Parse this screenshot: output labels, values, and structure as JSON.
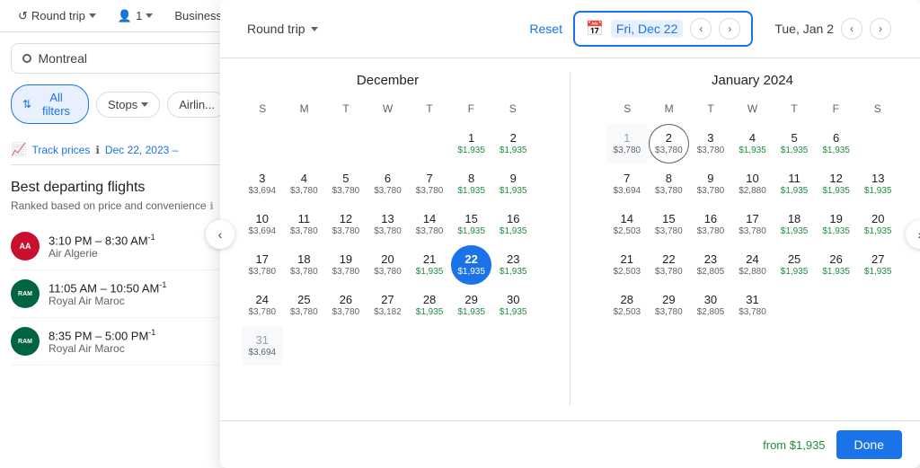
{
  "topbar": {
    "trip_type": "Round trip",
    "passengers": "1",
    "class": "Business",
    "trip_chevron": "▾",
    "passengers_chevron": "▾",
    "class_chevron": "▾"
  },
  "left_panel": {
    "search_placeholder": "Montreal",
    "filter_all": "All filters",
    "filter_stops": "Stops",
    "filter_airlines": "Airlin...",
    "track_prices_label": "Track prices",
    "track_prices_date": "Dec 22, 2023 –",
    "best_flights_title": "Best departing flights",
    "best_flights_sub": "Ranked based on price and convenience",
    "flights": [
      {
        "time": "3:10 PM – 8:30 AM",
        "suffix": "-1",
        "airline": "Air Algerie",
        "logo": "AA"
      },
      {
        "time": "11:05 AM – 10:50 AM",
        "suffix": "-1",
        "airline": "Royal Air Maroc",
        "logo": "RAM"
      },
      {
        "time": "8:35 PM – 5:00 PM",
        "suffix": "-1",
        "airline": "Royal Air Maroc",
        "logo": "RAM"
      }
    ]
  },
  "calendar_header": {
    "trip_type": "Round trip",
    "reset": "Reset",
    "depart_label": "Fri, Dec 22",
    "return_label": "Tue, Jan 2",
    "calendar_icon": "📅"
  },
  "december": {
    "title": "December",
    "day_headers": [
      "S",
      "M",
      "T",
      "W",
      "T",
      "F",
      "S"
    ],
    "weeks": [
      [
        {
          "num": "",
          "price": "",
          "type": "empty"
        },
        {
          "num": "",
          "price": "",
          "type": "empty"
        },
        {
          "num": "",
          "price": "",
          "type": "empty"
        },
        {
          "num": "",
          "price": "",
          "type": "empty"
        },
        {
          "num": "",
          "price": "",
          "type": "empty"
        },
        {
          "num": "1",
          "price": "$1,935",
          "type": "green"
        },
        {
          "num": "2",
          "price": "$1,935",
          "type": "green"
        }
      ],
      [
        {
          "num": "3",
          "price": "$3,694",
          "type": "gray"
        },
        {
          "num": "4",
          "price": "$3,780",
          "type": "gray"
        },
        {
          "num": "5",
          "price": "$3,780",
          "type": "gray"
        },
        {
          "num": "6",
          "price": "$3,780",
          "type": "gray"
        },
        {
          "num": "7",
          "price": "$3,780",
          "type": "gray"
        },
        {
          "num": "8",
          "price": "$1,935",
          "type": "green"
        },
        {
          "num": "9",
          "price": "$1,935",
          "type": "green"
        }
      ],
      [
        {
          "num": "10",
          "price": "$3,694",
          "type": "gray"
        },
        {
          "num": "11",
          "price": "$3,780",
          "type": "gray"
        },
        {
          "num": "12",
          "price": "$3,780",
          "type": "gray"
        },
        {
          "num": "13",
          "price": "$3,780",
          "type": "gray"
        },
        {
          "num": "14",
          "price": "$3,780",
          "type": "gray"
        },
        {
          "num": "15",
          "price": "$1,935",
          "type": "green"
        },
        {
          "num": "16",
          "price": "$1,935",
          "type": "green"
        }
      ],
      [
        {
          "num": "17",
          "price": "$3,780",
          "type": "gray"
        },
        {
          "num": "18",
          "price": "$3,780",
          "type": "gray"
        },
        {
          "num": "19",
          "price": "$3,780",
          "type": "gray"
        },
        {
          "num": "20",
          "price": "$3,780",
          "type": "gray"
        },
        {
          "num": "21",
          "price": "$1,935",
          "type": "green"
        },
        {
          "num": "22",
          "price": "$1,935",
          "type": "selected"
        },
        {
          "num": "23",
          "price": "$1,935",
          "type": "green"
        }
      ],
      [
        {
          "num": "24",
          "price": "$3,780",
          "type": "gray"
        },
        {
          "num": "25",
          "price": "$3,780",
          "type": "gray"
        },
        {
          "num": "26",
          "price": "$3,780",
          "type": "gray"
        },
        {
          "num": "27",
          "price": "$3,182",
          "type": "gray"
        },
        {
          "num": "28",
          "price": "$1,935",
          "type": "green"
        },
        {
          "num": "29",
          "price": "$1,935",
          "type": "green"
        },
        {
          "num": "30",
          "price": "$1,935",
          "type": "green"
        }
      ],
      [
        {
          "num": "31",
          "price": "$3,694",
          "type": "gray-muted"
        },
        {
          "num": "",
          "price": "",
          "type": "empty"
        },
        {
          "num": "",
          "price": "",
          "type": "empty"
        },
        {
          "num": "",
          "price": "",
          "type": "empty"
        },
        {
          "num": "",
          "price": "",
          "type": "empty"
        },
        {
          "num": "",
          "price": "",
          "type": "empty"
        },
        {
          "num": "",
          "price": "",
          "type": "empty"
        }
      ]
    ]
  },
  "january": {
    "title": "January 2024",
    "day_headers": [
      "S",
      "M",
      "T",
      "W",
      "T",
      "F",
      "S"
    ],
    "weeks": [
      [
        {
          "num": "1",
          "price": "$3,780",
          "type": "gray-muted"
        },
        {
          "num": "2",
          "price": "$3,780",
          "type": "today-ring"
        },
        {
          "num": "3",
          "price": "$3,780",
          "type": "gray"
        },
        {
          "num": "4",
          "price": "$1,935",
          "type": "green"
        },
        {
          "num": "5",
          "price": "$1,935",
          "type": "green"
        },
        {
          "num": "6",
          "price": "$1,935",
          "type": "green"
        },
        {
          "num": "",
          "price": "",
          "type": "empty"
        }
      ],
      [
        {
          "num": "7",
          "price": "$3,694",
          "type": "gray"
        },
        {
          "num": "8",
          "price": "$3,780",
          "type": "gray"
        },
        {
          "num": "9",
          "price": "$3,780",
          "type": "gray"
        },
        {
          "num": "10",
          "price": "$2,880",
          "type": "gray"
        },
        {
          "num": "11",
          "price": "$1,935",
          "type": "green"
        },
        {
          "num": "12",
          "price": "$1,935",
          "type": "green"
        },
        {
          "num": "13",
          "price": "$1,935",
          "type": "green"
        }
      ],
      [
        {
          "num": "14",
          "price": "$2,503",
          "type": "gray"
        },
        {
          "num": "15",
          "price": "$3,780",
          "type": "gray"
        },
        {
          "num": "16",
          "price": "$3,780",
          "type": "gray"
        },
        {
          "num": "17",
          "price": "$3,780",
          "type": "gray"
        },
        {
          "num": "18",
          "price": "$1,935",
          "type": "green"
        },
        {
          "num": "19",
          "price": "$1,935",
          "type": "green"
        },
        {
          "num": "20",
          "price": "$1,935",
          "type": "green"
        }
      ],
      [
        {
          "num": "21",
          "price": "$2,503",
          "type": "gray"
        },
        {
          "num": "22",
          "price": "$3,780",
          "type": "gray"
        },
        {
          "num": "23",
          "price": "$2,805",
          "type": "gray"
        },
        {
          "num": "24",
          "price": "$2,880",
          "type": "gray"
        },
        {
          "num": "25",
          "price": "$1,935",
          "type": "green"
        },
        {
          "num": "26",
          "price": "$1,935",
          "type": "green"
        },
        {
          "num": "27",
          "price": "$1,935",
          "type": "green"
        }
      ],
      [
        {
          "num": "28",
          "price": "$2,503",
          "type": "gray"
        },
        {
          "num": "29",
          "price": "$3,780",
          "type": "gray"
        },
        {
          "num": "30",
          "price": "$2,805",
          "type": "gray"
        },
        {
          "num": "31",
          "price": "$3,780",
          "type": "gray"
        },
        {
          "num": "",
          "price": "",
          "type": "empty"
        },
        {
          "num": "",
          "price": "",
          "type": "empty"
        },
        {
          "num": "",
          "price": "",
          "type": "empty"
        }
      ]
    ]
  },
  "footer": {
    "from_price": "from $1,935",
    "done_label": "Done"
  }
}
